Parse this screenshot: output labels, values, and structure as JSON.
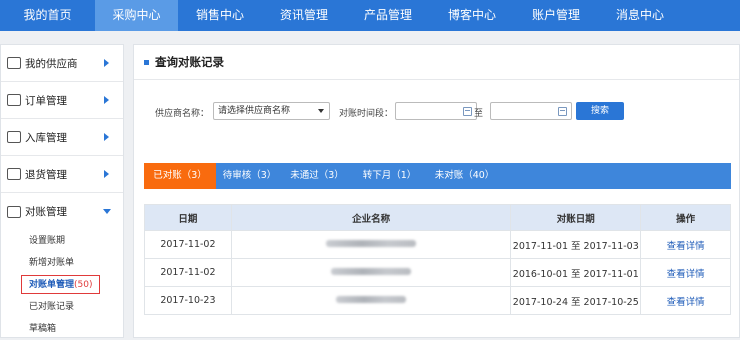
{
  "nav": {
    "items": [
      {
        "label": "我的首页",
        "active": false
      },
      {
        "label": "采购中心",
        "active": true
      },
      {
        "label": "销售中心",
        "active": false
      },
      {
        "label": "资讯管理",
        "active": false
      },
      {
        "label": "产品管理",
        "active": false
      },
      {
        "label": "博客中心",
        "active": false
      },
      {
        "label": "账户管理",
        "active": false
      },
      {
        "label": "消息中心",
        "active": false
      }
    ]
  },
  "sidebar": {
    "groups": [
      {
        "label": "我的供应商",
        "icon": "supplier-icon"
      },
      {
        "label": "订单管理",
        "icon": "order-icon"
      },
      {
        "label": "入库管理",
        "icon": "inbound-icon"
      },
      {
        "label": "退货管理",
        "icon": "return-icon"
      },
      {
        "label": "对账管理",
        "icon": "reconcile-icon"
      }
    ],
    "sub_items": [
      {
        "label": "设置账期"
      },
      {
        "label": "新增对账单"
      },
      {
        "label": "对账单管理",
        "count": "(50)"
      },
      {
        "label": "已对账记录"
      },
      {
        "label": "草稿箱"
      }
    ]
  },
  "main": {
    "title": "查询对账记录",
    "filters": {
      "supplier_label": "供应商名称：",
      "supplier_value": "请选择供应商名称",
      "period_label": "对账时间段：",
      "to_label": "至",
      "search_label": "搜索"
    },
    "tabs": [
      {
        "label": "已对账（3）",
        "active": true
      },
      {
        "label": "待审核（3）",
        "active": false
      },
      {
        "label": "未通过（3）",
        "active": false
      },
      {
        "label": "转下月（1）",
        "active": false
      },
      {
        "label": "未对账（40）",
        "active": false
      }
    ],
    "table": {
      "headers": [
        "日期",
        "企业名称",
        "对账日期",
        "操作"
      ],
      "rows": [
        {
          "date": "2017-11-02",
          "range": "2017-11-01 至 2017-11-03",
          "action": "查看详情"
        },
        {
          "date": "2017-11-02",
          "range": "2016-10-01 至 2017-11-01",
          "action": "查看详情"
        },
        {
          "date": "2017-10-23",
          "range": "2017-10-24 至 2017-10-25",
          "action": "查看详情"
        }
      ]
    }
  },
  "colors": {
    "nav_bg": "#2a76d6",
    "active_tab": "#f96b0e",
    "highlight_border": "#e03a3a"
  }
}
